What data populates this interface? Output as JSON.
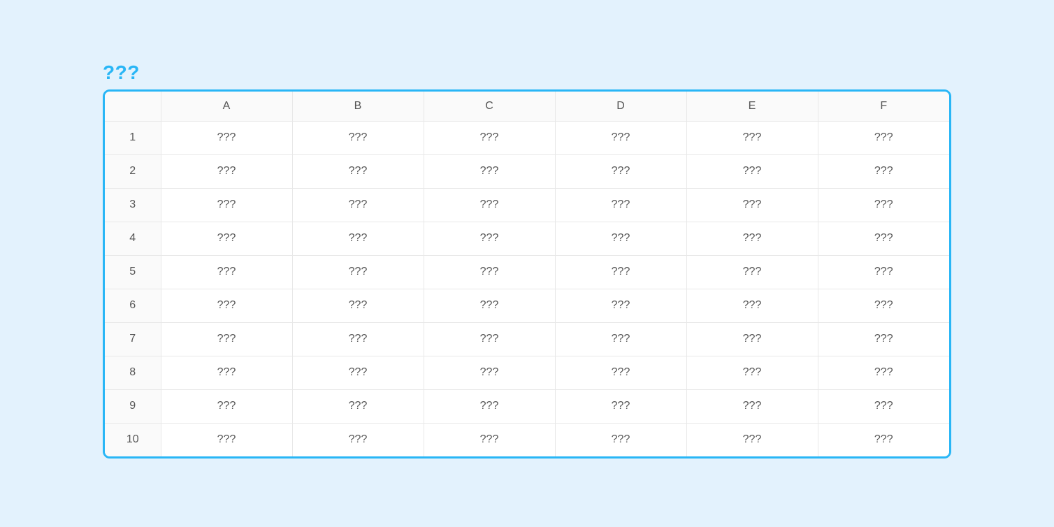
{
  "title": "???",
  "columns": [
    "A",
    "B",
    "C",
    "D",
    "E",
    "F"
  ],
  "rows": [
    {
      "n": "1",
      "cells": [
        "???",
        "???",
        "???",
        "???",
        "???",
        "???"
      ]
    },
    {
      "n": "2",
      "cells": [
        "???",
        "???",
        "???",
        "???",
        "???",
        "???"
      ]
    },
    {
      "n": "3",
      "cells": [
        "???",
        "???",
        "???",
        "???",
        "???",
        "???"
      ]
    },
    {
      "n": "4",
      "cells": [
        "???",
        "???",
        "???",
        "???",
        "???",
        "???"
      ]
    },
    {
      "n": "5",
      "cells": [
        "???",
        "???",
        "???",
        "???",
        "???",
        "???"
      ]
    },
    {
      "n": "6",
      "cells": [
        "???",
        "???",
        "???",
        "???",
        "???",
        "???"
      ]
    },
    {
      "n": "7",
      "cells": [
        "???",
        "???",
        "???",
        "???",
        "???",
        "???"
      ]
    },
    {
      "n": "8",
      "cells": [
        "???",
        "???",
        "???",
        "???",
        "???",
        "???"
      ]
    },
    {
      "n": "9",
      "cells": [
        "???",
        "???",
        "???",
        "???",
        "???",
        "???"
      ]
    },
    {
      "n": "10",
      "cells": [
        "???",
        "???",
        "???",
        "???",
        "???",
        "???"
      ]
    }
  ]
}
